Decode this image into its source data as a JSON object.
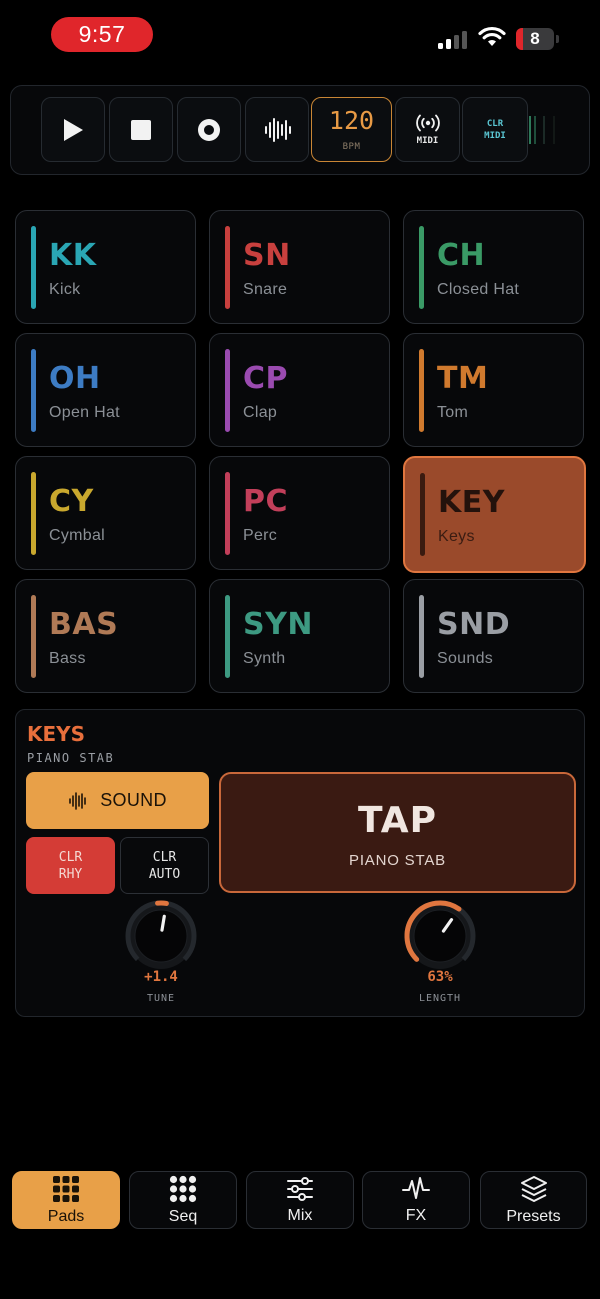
{
  "status": {
    "time": "9:57",
    "battery": "8",
    "battery_color": "#e0262b"
  },
  "transport": {
    "buttons": [
      {
        "name": "play-button",
        "icon": "play-icon"
      },
      {
        "name": "stop-button",
        "icon": "stop-icon"
      },
      {
        "name": "record-button",
        "icon": "record-icon"
      },
      {
        "name": "waveform-button",
        "icon": "waveform-icon"
      }
    ],
    "bpm": {
      "value": "120",
      "label": "BPM"
    },
    "midi": {
      "label": "MIDI",
      "icon": "broadcast-icon"
    },
    "clr_midi": {
      "line1": "CLR",
      "line2": "MIDI"
    }
  },
  "pads": [
    {
      "code": "KK",
      "name": "Kick",
      "color": "#2aa6b4",
      "active": false
    },
    {
      "code": "SN",
      "name": "Snare",
      "color": "#c8403e",
      "active": false
    },
    {
      "code": "CH",
      "name": "Closed Hat",
      "color": "#3a9a66",
      "active": false
    },
    {
      "code": "OH",
      "name": "Open Hat",
      "color": "#3d7cc4",
      "active": false
    },
    {
      "code": "CP",
      "name": "Clap",
      "color": "#9a4bb0",
      "active": false
    },
    {
      "code": "TM",
      "name": "Tom",
      "color": "#d07a2e",
      "active": false
    },
    {
      "code": "CY",
      "name": "Cymbal",
      "color": "#c9a82e",
      "active": false
    },
    {
      "code": "PC",
      "name": "Perc",
      "color": "#c23f5a",
      "active": false
    },
    {
      "code": "KEY",
      "name": "Keys",
      "color": "#e0763f",
      "active": true
    },
    {
      "code": "BAS",
      "name": "Bass",
      "color": "#b07a56",
      "active": false
    },
    {
      "code": "SYN",
      "name": "Synth",
      "color": "#3d9a82",
      "active": false
    },
    {
      "code": "SND",
      "name": "Sounds",
      "color": "#9a9ea4",
      "active": false
    }
  ],
  "panel": {
    "title": "KEYS",
    "subtitle": "PIANO STAB",
    "sound_label": "SOUND",
    "clr_rhy": {
      "line1": "CLR",
      "line2": "RHY"
    },
    "clr_auto": {
      "line1": "CLR",
      "line2": "AUTO"
    },
    "tap": {
      "title": "TAP",
      "subtitle": "PIANO STAB"
    },
    "knobs": [
      {
        "value": "+1.4",
        "label": "TUNE",
        "level": 0.535
      },
      {
        "value": "63%",
        "label": "LENGTH",
        "level": 0.63
      }
    ]
  },
  "nav": [
    {
      "label": "Pads",
      "icon": "grid-icon",
      "active": true
    },
    {
      "label": "Seq",
      "icon": "dots-grid-icon",
      "active": false
    },
    {
      "label": "Mix",
      "icon": "sliders-icon",
      "active": false
    },
    {
      "label": "FX",
      "icon": "pulse-icon",
      "active": false
    },
    {
      "label": "Presets",
      "icon": "layers-icon",
      "active": false
    }
  ],
  "colors": {
    "accent": "#e0763f",
    "orange": "#e8a048",
    "red": "#d43c36"
  }
}
